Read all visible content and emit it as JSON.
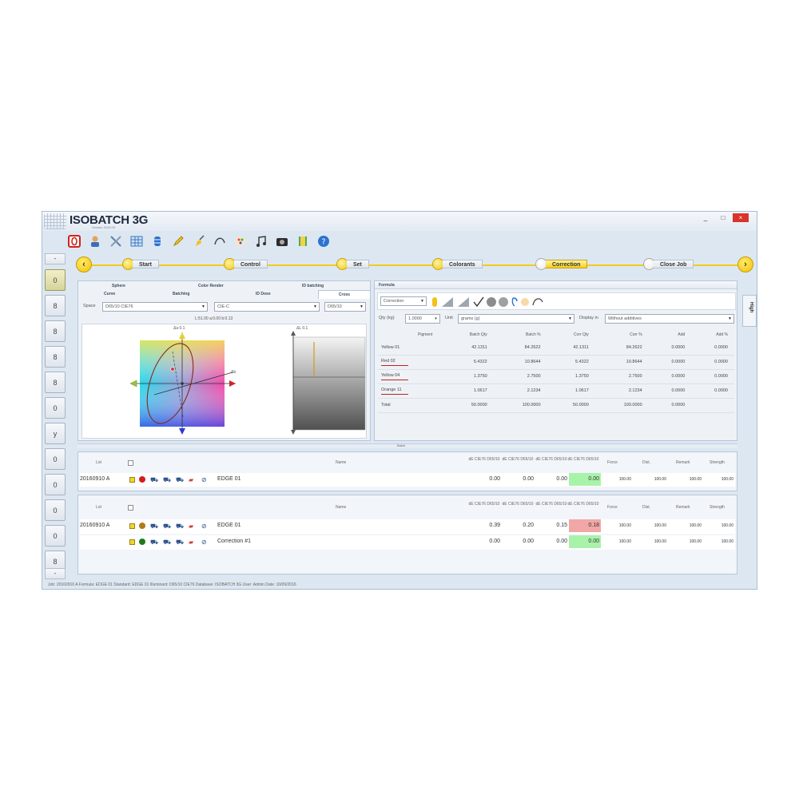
{
  "window": {
    "title": "ISOBATCH 3G",
    "logo_sub": "Version 2016.09",
    "minimize": "_",
    "maximize": "□",
    "close": "×"
  },
  "toolbar": {
    "icons": [
      "stop-icon",
      "user-icon",
      "tools-icon",
      "grid-icon",
      "database-icon",
      "pencil-icon",
      "brush-icon",
      "curve-icon",
      "palette-icon",
      "music-icon",
      "camera-icon",
      "book-icon",
      "help-icon"
    ]
  },
  "left_nav": {
    "top_small": "-",
    "bottom_small": "-",
    "items": [
      "0",
      "8",
      "8",
      "8",
      "8",
      "0",
      "y",
      "0",
      "0",
      "0",
      "0",
      "8"
    ]
  },
  "workflow": {
    "prev": "‹",
    "next": "›",
    "steps": [
      {
        "label": "Start",
        "state": "done"
      },
      {
        "label": "Control",
        "state": "done"
      },
      {
        "label": "Set",
        "state": "done"
      },
      {
        "label": "Colorants",
        "state": "done"
      },
      {
        "label": "Correction",
        "state": "active"
      },
      {
        "label": "Close Job",
        "state": "open"
      }
    ]
  },
  "right_tab": "High",
  "left_panel": {
    "tabs_row1": [
      "Sphere",
      "Color Render",
      "ID batching"
    ],
    "tabs_row2": [
      "Curve",
      "Batching",
      "ID Dose",
      "Cross"
    ],
    "space_label": "Space",
    "space_value": "D65/10 CIE76",
    "illum_value": "CIE-C",
    "small_value": "D65/10",
    "readout": "L:51.00  a:0.00  b:0.13",
    "da_label": "Δa 0.1",
    "db_label": "Δb",
    "dl_label": "ΔL 0.1"
  },
  "formula_panel": {
    "title": "Formula",
    "mode_value": "Correction",
    "qty_label": "Qty (kg)",
    "qty_value": "1.0000",
    "unit_label": "Unit",
    "unit_value": "grams (g)",
    "display_label": "Display in",
    "display_value": "Without additives",
    "columns": [
      "Pigment",
      "Batch Qty",
      "Batch %",
      "Corr Qty",
      "Corr %",
      "Add",
      "Add %"
    ],
    "rows": [
      {
        "name": "Yellow 01",
        "line": false,
        "values": [
          "42.1311",
          "84.2622",
          "42.1311",
          "84.2622",
          "0.0000",
          "0.0000"
        ]
      },
      {
        "name": "Red 02",
        "line": true,
        "values": [
          "5.4322",
          "10.8644",
          "5.4322",
          "10.8644",
          "0.0000",
          "0.0000"
        ]
      },
      {
        "name": "Yellow 04",
        "line": true,
        "values": [
          "1.3750",
          "2.7500",
          "1.3750",
          "2.7500",
          "0.0000",
          "0.0000"
        ]
      },
      {
        "name": "Orange 11",
        "line": true,
        "values": [
          "1.0617",
          "2.1234",
          "1.0617",
          "2.1234",
          "0.0000",
          "0.0000"
        ]
      },
      {
        "name": "Total",
        "line": false,
        "values": [
          "50.0000",
          "100.0000",
          "50.0000",
          "100.0000",
          "0.0000",
          ""
        ]
      }
    ]
  },
  "splitter_label": "Batch",
  "batch_table_1": {
    "columns": [
      "Lot",
      "",
      "Name",
      "dE CIE76 D65/10",
      "dE CIE76 D65/10",
      "dE CIE76 D65/10",
      "dE CIE76 D65/10",
      "Force",
      "Dist.",
      "Remark",
      "Strength"
    ],
    "rows": [
      {
        "lot": "20160910 A",
        "checked": true,
        "dot": "#d81a1a",
        "name": "EDGE 01",
        "values": [
          "0.00",
          "0.00",
          "0.00",
          "0.00",
          "100.00",
          "100.00",
          "100.00",
          "100.00"
        ],
        "highlight": "green"
      }
    ]
  },
  "batch_table_2": {
    "columns": [
      "Lot",
      "",
      "Name",
      "dE CIE76 D65/10",
      "dE CIE76 D65/10",
      "dE CIE76 D65/10",
      "dE CIE76 D65/10",
      "Force",
      "Dist.",
      "Remark",
      "Strength"
    ],
    "rows": [
      {
        "lot": "20160910 A",
        "checked": true,
        "dot": "#b07a18",
        "name": "EDGE 01",
        "values": [
          "0.39",
          "0.20",
          "0.15",
          "0.18",
          "100.00",
          "100.00",
          "100.00",
          "100.00"
        ],
        "highlight": "red"
      },
      {
        "lot": "",
        "checked": true,
        "dot": "#1f7a1f",
        "name": "Correction #1",
        "values": [
          "0.00",
          "0.00",
          "0.00",
          "0.00",
          "100.00",
          "100.00",
          "100.00",
          "100.00"
        ],
        "highlight": "green"
      }
    ]
  },
  "status_bar": "Job: 20160910 A   Formula: EDGE 01   Standard: EDGE 01   Illuminant: D65/10 CIE76   Database: ISOBATCH 3G   User: Admin   Date: 10/09/2016"
}
